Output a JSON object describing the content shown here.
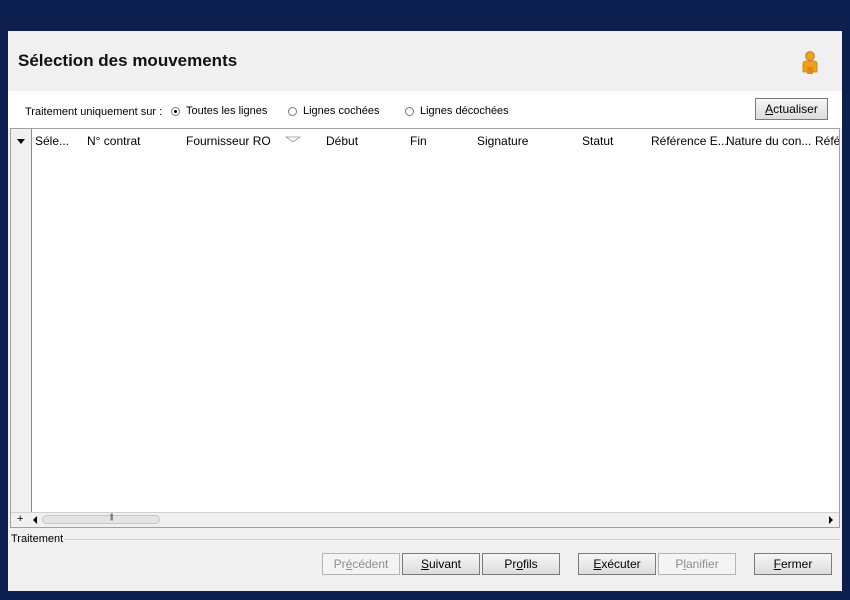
{
  "window": {
    "title": "Sélection des mouvements",
    "icon": "user-icon"
  },
  "toolbar": {
    "label": "Traitement uniquement sur :",
    "radios": [
      {
        "label": "Toutes les lignes",
        "checked": true
      },
      {
        "label": "Lignes cochées",
        "checked": false
      },
      {
        "label": "Lignes décochées",
        "checked": false
      }
    ],
    "refresh_label_underlined": "A",
    "refresh_label_rest": "ctualiser"
  },
  "grid": {
    "columns": [
      "Séle...",
      "N° contrat",
      "Fournisseur RO",
      "Début",
      "Fin",
      "Signature",
      "Statut",
      "Référence E...",
      "Nature du con...",
      "Référ"
    ],
    "rows": []
  },
  "footer": {
    "section_label": "Traitement",
    "buttons": {
      "previous": {
        "pre": "Pr",
        "u": "é",
        "post": "cédent",
        "enabled": false
      },
      "next": {
        "pre": "",
        "u": "S",
        "post": "uivant",
        "enabled": true
      },
      "profiles": {
        "pre": "Pr",
        "u": "o",
        "post": "fils",
        "enabled": true
      },
      "execute": {
        "pre": "",
        "u": "E",
        "post": "xécuter",
        "enabled": true
      },
      "schedule": {
        "pre": "P",
        "u": "l",
        "post": "anifier",
        "enabled": false
      },
      "close": {
        "pre": "",
        "u": "F",
        "post": "ermer",
        "enabled": true
      }
    }
  },
  "colors": {
    "background": "#0c1f4e",
    "window": "#f0f0f0",
    "user_icon": "#f0a020"
  }
}
